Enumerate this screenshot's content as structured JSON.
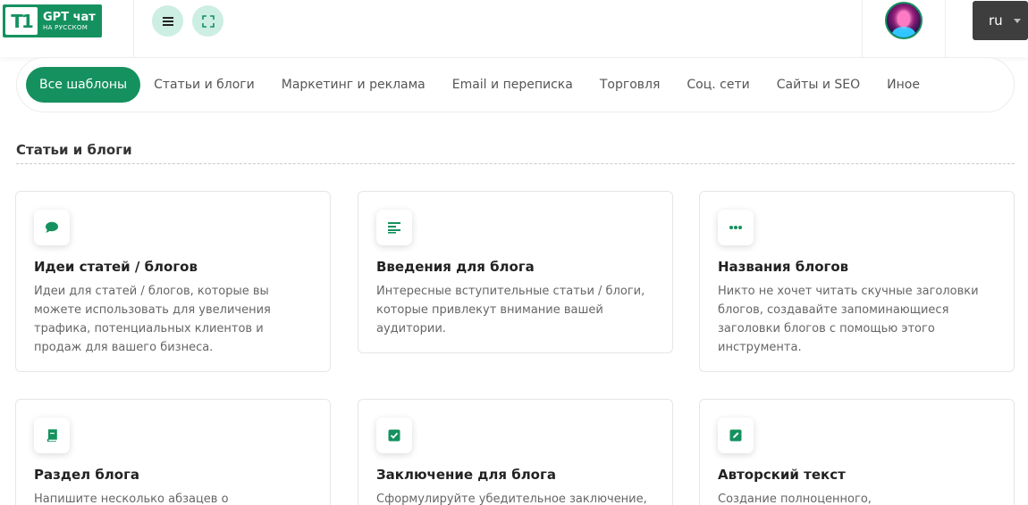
{
  "header": {
    "logo_mark": "T1",
    "logo_title": "GPT чат",
    "logo_subtitle": "НА РУССКОМ",
    "language": "ru"
  },
  "tabs": [
    {
      "label": "Все шаблоны",
      "active": true
    },
    {
      "label": "Статьи и блоги",
      "active": false
    },
    {
      "label": "Маркетинг и реклама",
      "active": false
    },
    {
      "label": "Email и переписка",
      "active": false
    },
    {
      "label": "Торговля",
      "active": false
    },
    {
      "label": "Соц. сети",
      "active": false
    },
    {
      "label": "Сайты и SEO",
      "active": false
    },
    {
      "label": "Иное",
      "active": false
    }
  ],
  "section": {
    "title": "Статьи и блоги"
  },
  "cards": [
    {
      "icon": "speech-bubble-icon",
      "title": "Идеи статей / блогов",
      "description": "Идеи для статей / блогов, которые вы можете использовать для увеличения трафика, потенциальных клиентов и продаж для вашего бизнеса."
    },
    {
      "icon": "align-left-icon",
      "title": "Введения для блога",
      "description": "Интересные вступительные статьи / блоги, которые привлекут внимание вашей аудитории."
    },
    {
      "icon": "ellipsis-icon",
      "title": "Названия блогов",
      "description": "Никто не хочет читать скучные заголовки блогов, создавайте запоминающиеся заголовки блогов с помощью этого инструмента."
    },
    {
      "icon": "book-icon",
      "title": "Раздел блога",
      "description": "Напишите несколько абзацев о подзаголовке"
    },
    {
      "icon": "check-square-icon",
      "title": "Заключение для блога",
      "description": "Сформулируйте убедительное заключение,"
    },
    {
      "icon": "pen-square-icon",
      "title": "Авторский текст",
      "description": "Создание полноценного,"
    }
  ],
  "colors": {
    "brand": "#15915f",
    "icon_button_bg": "#cdeee3",
    "lang_bg": "#3e3e3e"
  }
}
